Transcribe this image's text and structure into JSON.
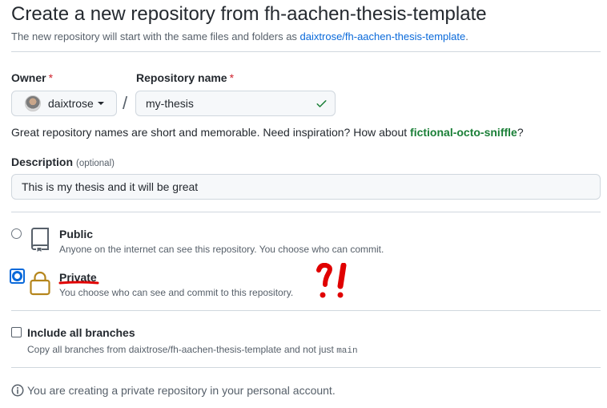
{
  "header": {
    "title": "Create a new repository from fh-aachen-thesis-template",
    "subtitle_prefix": "The new repository will start with the same files and folders as ",
    "template_link": "daixtrose/fh-aachen-thesis-template",
    "subtitle_suffix": "."
  },
  "owner": {
    "label": "Owner",
    "required_mark": "*",
    "value": "daixtrose"
  },
  "repository_name": {
    "label": "Repository name",
    "required_mark": "*",
    "value": "my-thesis",
    "separator": "/"
  },
  "name_hint": {
    "text": "Great repository names are short and memorable. Need inspiration? How about ",
    "suggestion": "fictional-octo-sniffle",
    "suffix": "?"
  },
  "description": {
    "label": "Description",
    "optional_note": "(optional)",
    "value": "This is my thesis and it will be great"
  },
  "visibility": {
    "public": {
      "title": "Public",
      "description": "Anyone on the internet can see this repository. You choose who can commit.",
      "selected": false
    },
    "private": {
      "title": "Private",
      "description": "You choose who can see and commit to this repository.",
      "selected": true
    }
  },
  "annotation": {
    "mark": "?!",
    "color": "#e00000"
  },
  "include_branches": {
    "label": "Include all branches",
    "description_prefix": "Copy all branches from daixtrose/fh-aachen-thesis-template and not just ",
    "branch": "main",
    "checked": false
  },
  "info": {
    "text": "You are creating a private repository in your personal account."
  },
  "colors": {
    "link": "#0969da",
    "success": "#1a7f37",
    "danger": "#cf222e",
    "lock_icon": "#b5851b"
  }
}
